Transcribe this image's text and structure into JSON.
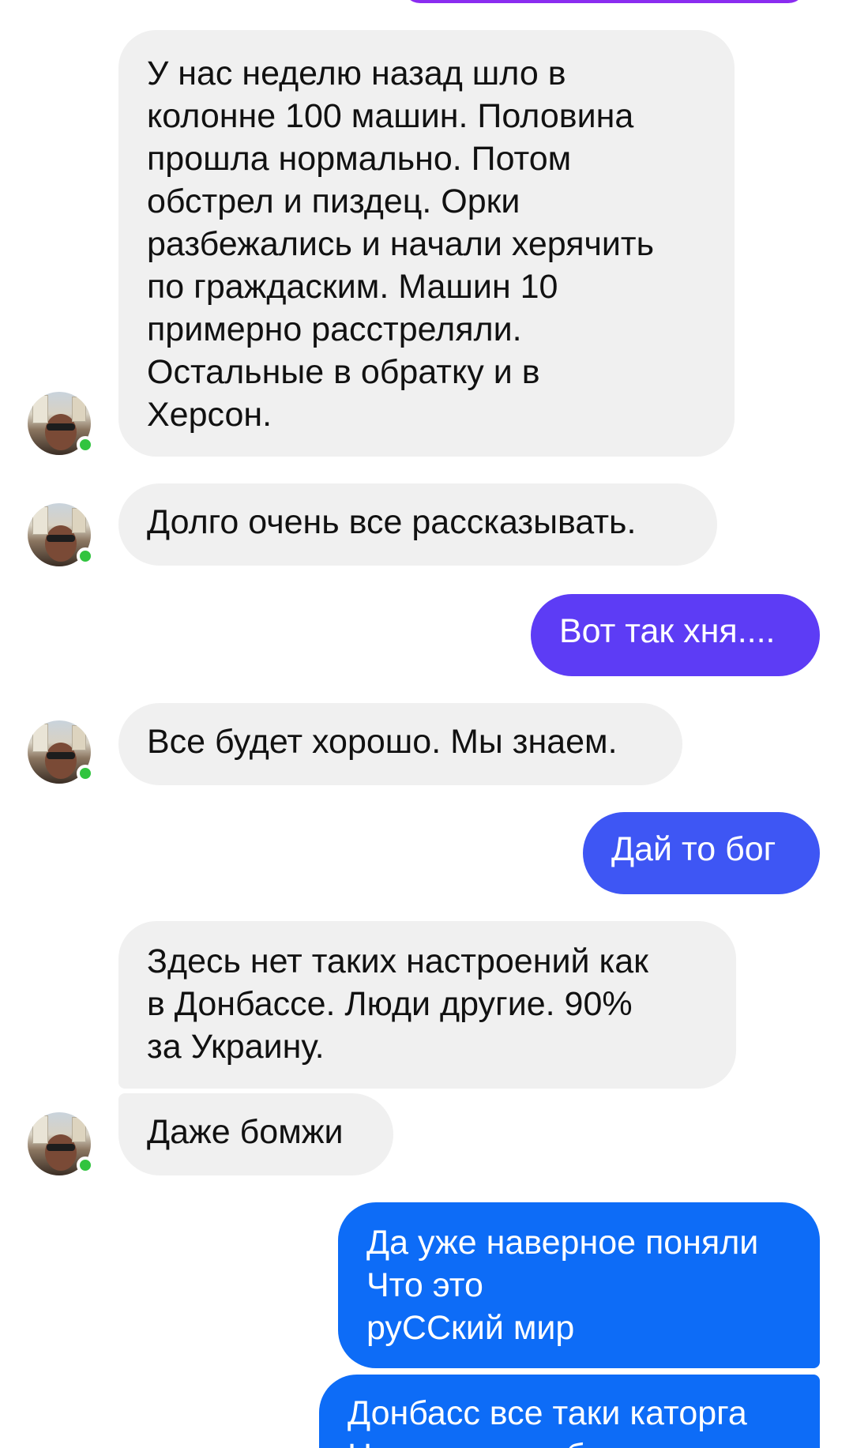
{
  "colors": {
    "incoming_bubble": "#f0f0f0",
    "outgoing_purple": "#5d3cf5",
    "outgoing_indigo": "#3e56f4",
    "outgoing_blue": "#0d6cf7",
    "online_dot": "#31c43f"
  },
  "messages": [
    {
      "sender": "contact",
      "text": "У нас неделю назад шло в\nколонне 100 машин. Половина\nпрошла нормально. Потом\nобстрел и пиздец. Орки\nразбежались и начали херячить\nпо граждаским. Машин 10\nпримерно расстреляли.\nОстальные в обратку и в\nХерсон."
    },
    {
      "sender": "contact",
      "text": "Долго очень все рассказывать."
    },
    {
      "sender": "me",
      "text": "Вот так хня...."
    },
    {
      "sender": "contact",
      "text": "Все будет хорошо. Мы знаем."
    },
    {
      "sender": "me",
      "text": "Дай то бог"
    },
    {
      "sender": "contact",
      "text": "Здесь нет таких настроений как\nв Донбассе. Люди другие. 90%\nза Украину."
    },
    {
      "sender": "contact",
      "text": "Даже бомжи"
    },
    {
      "sender": "me",
      "text": "Да уже наверное поняли\nЧто это\nруССкий мир"
    },
    {
      "sender": "me",
      "text": "Донбасс все таки каторга\nНаселенная сбродом"
    }
  ],
  "avatar": {
    "icon": "contact-avatar",
    "status": "online"
  }
}
